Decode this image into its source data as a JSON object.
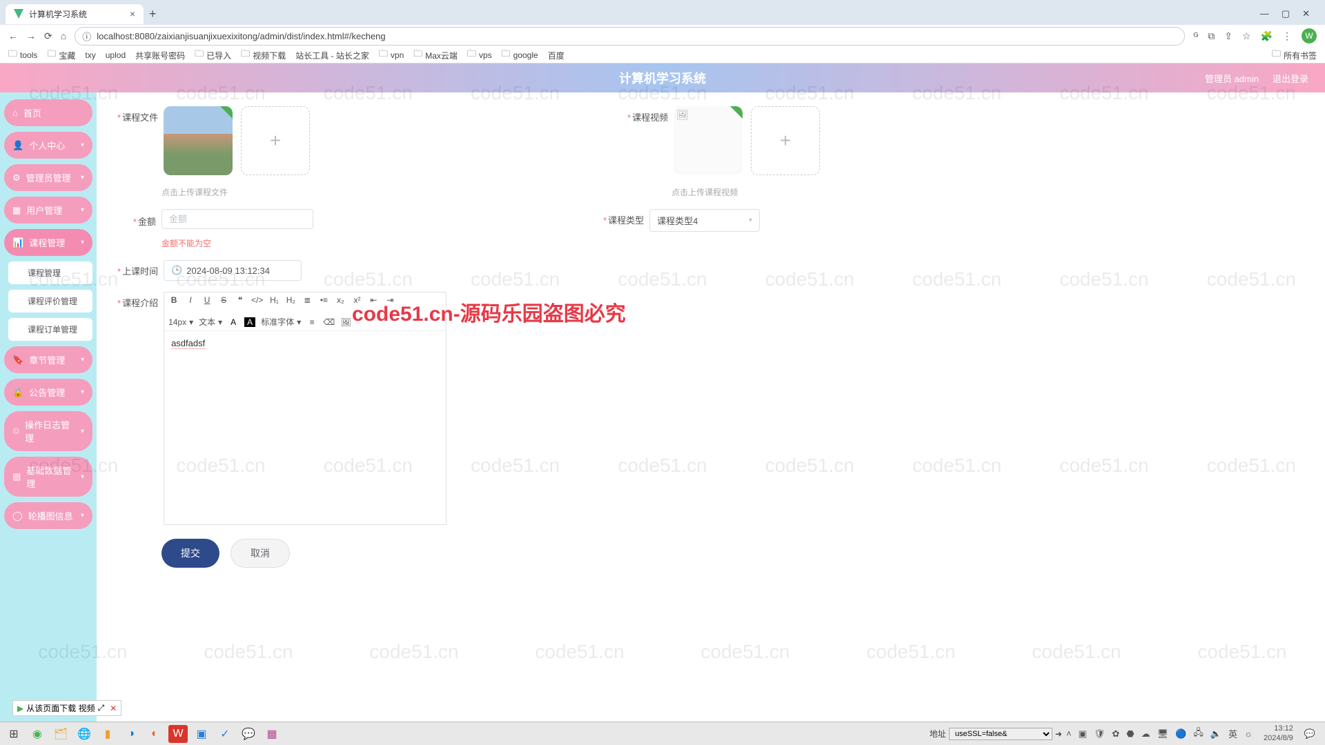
{
  "browser": {
    "tab_title": "计算机学习系统",
    "url": "localhost:8080/zaixianjisuanjixuexixitong/admin/dist/index.html#/kecheng",
    "avatar_letter": "W",
    "bookmarks": [
      "tools",
      "宝藏",
      "txy",
      "uplod",
      "共享账号密码",
      "已导入",
      "视频下载",
      "站长工具 - 站长之家",
      "vpn",
      "Max云端",
      "vps",
      "google",
      "百度"
    ],
    "bookmarks_right": "所有书签"
  },
  "app": {
    "title": "计算机学习系统",
    "user_label": "管理员 admin",
    "logout": "退出登录"
  },
  "sidebar": {
    "items": [
      {
        "icon": "⌂",
        "label": "首页",
        "chev": false
      },
      {
        "icon": "👤",
        "label": "个人中心",
        "chev": true
      },
      {
        "icon": "⚙",
        "label": "管理员管理",
        "chev": true
      },
      {
        "icon": "▦",
        "label": "用户管理",
        "chev": true
      },
      {
        "icon": "📊",
        "label": "课程管理",
        "chev": true,
        "active": true,
        "subs": [
          "课程管理",
          "课程评价管理",
          "课程订单管理"
        ]
      },
      {
        "icon": "🔖",
        "label": "章节管理",
        "chev": true
      },
      {
        "icon": "🔒",
        "label": "公告管理",
        "chev": true
      },
      {
        "icon": "⏲",
        "label": "操作日志管理",
        "chev": true
      },
      {
        "icon": "▤",
        "label": "基础数据管理",
        "chev": true
      },
      {
        "icon": "◯",
        "label": "轮播图信息",
        "chev": true
      }
    ]
  },
  "form": {
    "file_label": "课程文件",
    "file_hint": "点击上传课程文件",
    "video_label": "课程视频",
    "video_hint": "点击上传课程视频",
    "price_label": "金额",
    "price_placeholder": "金额",
    "price_error": "金额不能为空",
    "type_label": "课程类型",
    "type_value": "课程类型4",
    "time_label": "上课时间",
    "time_value": "2024-08-09 13:12:34",
    "intro_label": "课程介绍",
    "editor": {
      "font_size": "14px",
      "font_style": "文本",
      "font_family": "标准字体",
      "content": "asdfadsf"
    },
    "submit": "提交",
    "cancel": "取消"
  },
  "overlay": "code51.cn-源码乐园盗图必究",
  "download_widget": "从该页面下载 视频",
  "taskbar": {
    "sql_label": "地址",
    "sql_value": "useSSL=false&",
    "time": "13:12",
    "date": "2024/8/9",
    "ime": "英",
    "lang": "☼"
  },
  "watermark_text": "code51.cn"
}
